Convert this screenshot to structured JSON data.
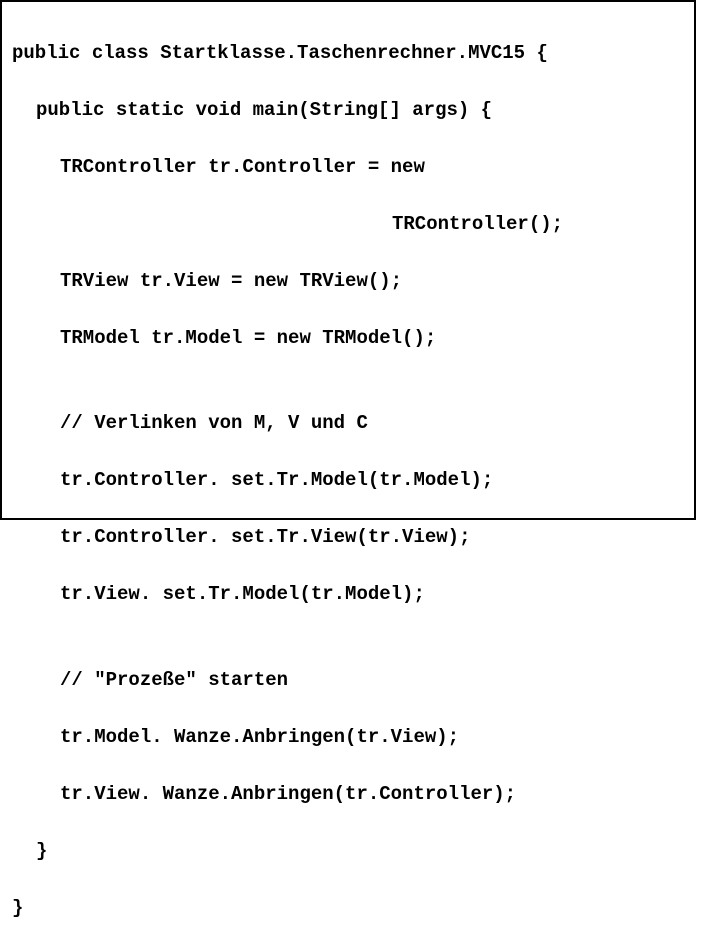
{
  "code": {
    "l1": "public class Startklasse.Taschenrechner.MVC15 {",
    "l2": "public static void main(String[] args) {",
    "l3": "TRController tr.Controller = new",
    "l4": "TRController();",
    "l5": "TRView tr.View = new TRView();",
    "l6": "TRModel tr.Model = new TRModel();",
    "l7": "",
    "l8": "// Verlinken von M, V und C",
    "l9": "tr.Controller. set.Tr.Model(tr.Model);",
    "l10": "tr.Controller. set.Tr.View(tr.View);",
    "l11": "tr.View. set.Tr.Model(tr.Model);",
    "l12": "",
    "l13": "// \"Prozeße\" starten",
    "l14": "tr.Model. Wanze.Anbringen(tr.View);",
    "l15": "tr.View. Wanze.Anbringen(tr.Controller);",
    "l16": "}",
    "l17": "}"
  }
}
